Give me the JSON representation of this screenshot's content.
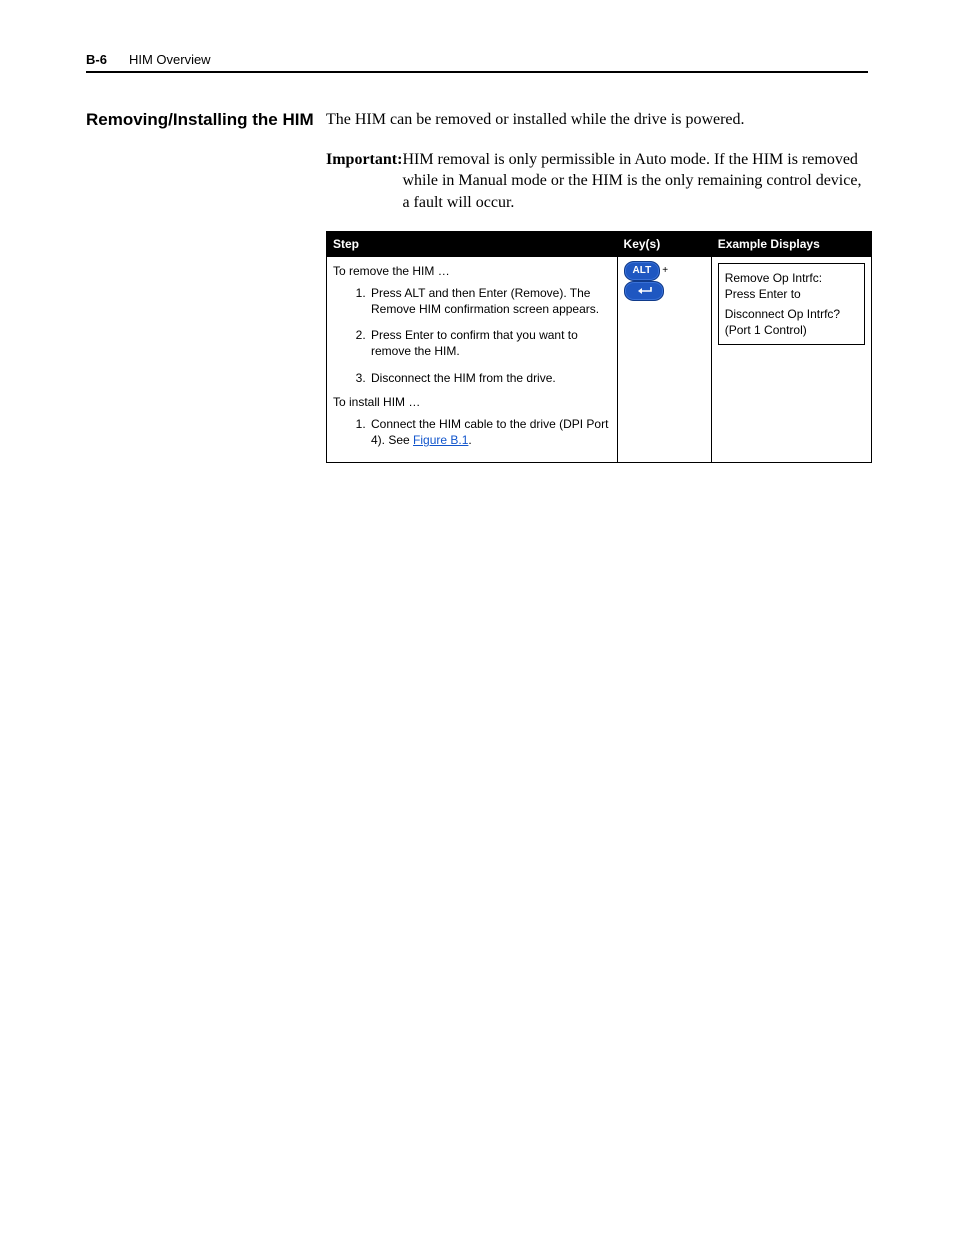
{
  "header": {
    "page_number": "B-6",
    "section_title": "HIM Overview"
  },
  "section": {
    "heading": "Removing/Installing the HIM",
    "intro": "The HIM can be removed or installed while the drive is powered.",
    "important_label": "Important:",
    "important_text": "HIM removal is only permissible in Auto mode. If the HIM is removed while in Manual mode or the HIM is the only remaining control device, a fault will occur."
  },
  "table": {
    "headers": {
      "step": "Step",
      "keys": "Key(s)",
      "displays": "Example Displays"
    },
    "remove_heading": "To remove the HIM …",
    "remove_steps": [
      "Press ALT and then Enter (Remove). The Remove HIM confirmation screen appears.",
      "Press Enter to confirm that you want to remove the HIM.",
      "Disconnect the HIM from the drive."
    ],
    "install_heading": "To install HIM …",
    "install_step_prefix": "Connect the HIM cable to the drive (DPI Port 4). See ",
    "install_step_link": "Figure B.1",
    "install_step_suffix": ".",
    "keys": {
      "alt_label": "ALT",
      "plus": "+"
    },
    "display": {
      "line1": "Remove Op Intrfc:",
      "line2": "Press Enter to",
      "line3": "Disconnect Op Intrfc?",
      "line4": "(Port 1 Control)"
    }
  }
}
